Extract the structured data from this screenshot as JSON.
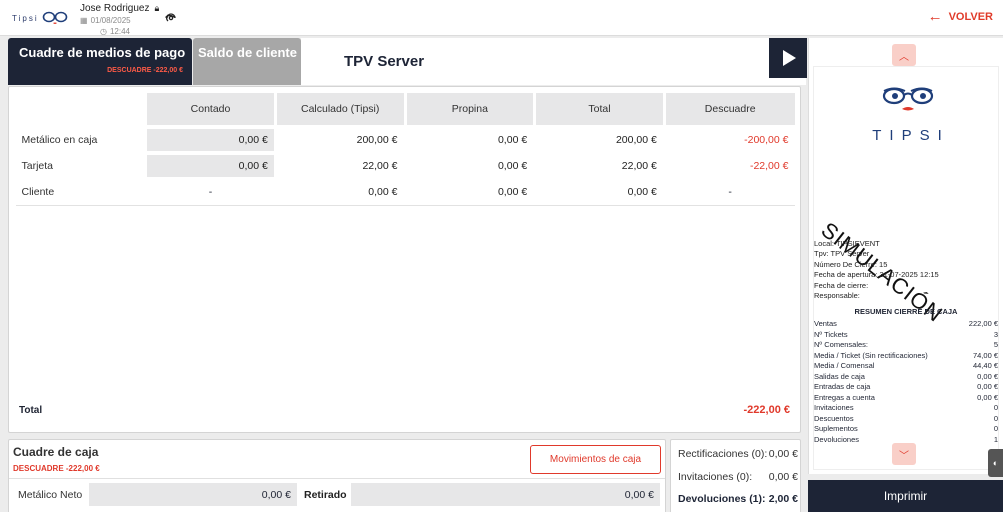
{
  "top_bar": {
    "brand": "Tipsi",
    "user_name": "Jose Rodriguez",
    "date": "01/08/2025",
    "time": "12:44",
    "back_label": "VOLVER"
  },
  "tabs": {
    "active_label": "Cuadre de medios de pago",
    "active_sub": "DESCUADRE -222,00 €",
    "inactive_label": "Saldo de cliente"
  },
  "page_title": "TPV Server",
  "table": {
    "headers": [
      "Contado",
      "Calculado (Tipsi)",
      "Propina",
      "Total",
      "Descuadre"
    ],
    "rows": [
      {
        "label": "Metálico en caja",
        "contado": "0,00 €",
        "calculado": "200,00 €",
        "propina": "0,00 €",
        "total": "200,00 €",
        "descuadre": "-200,00 €"
      },
      {
        "label": "Tarjeta",
        "contado": "0,00 €",
        "calculado": "22,00 €",
        "propina": "0,00 €",
        "total": "22,00 €",
        "descuadre": "-22,00 €"
      },
      {
        "label": "Cliente",
        "contado": "-",
        "calculado": "0,00 €",
        "propina": "0,00 €",
        "total": "0,00 €",
        "descuadre": "-"
      }
    ],
    "total_label": "Total",
    "total_value": "-222,00 €"
  },
  "cash": {
    "title": "Cuadre de caja",
    "descuadre": "DESCUADRE -222,00 €",
    "movements_button": "Movimientos de caja",
    "neto_label": "Metálico Neto",
    "neto_value": "0,00 €",
    "retirado_label": "Retirado",
    "retirado_value": "0,00 €"
  },
  "summary": {
    "rectificaciones_label": "Rectificaciones (0):",
    "rectificaciones_value": "0,00 €",
    "invitaciones_label": "Invitaciones (0):",
    "invitaciones_value": "0,00 €",
    "devoluciones_label": "Devoluciones (1):",
    "devoluciones_value": "2,00 €"
  },
  "ticket": {
    "brand": "TIPSI",
    "watermark": "SIMULACIÓN",
    "info": [
      "Local: TIPSIEVENT",
      "Tpv: TPV Server",
      "Número De Cierre: 15",
      "Fecha de apertura: 31-07-2025 12:15",
      "Fecha de cierre:",
      "Responsable:"
    ],
    "summary_title": "RESUMEN CIERRE DE CAJA",
    "summary_rows": [
      {
        "label": "Ventas",
        "value": "222,00 €"
      },
      {
        "label": "Nº Tickets",
        "value": "3"
      },
      {
        "label": "Nº Comensales:",
        "value": "5"
      },
      {
        "label": "Media / Ticket (Sin rectificaciones)",
        "value": "74,00 €"
      },
      {
        "label": "Media / Comensal",
        "value": "44,40 €"
      },
      {
        "label": "Salidas de caja",
        "value": "0,00 €"
      },
      {
        "label": "Entradas de caja",
        "value": "0,00 €"
      },
      {
        "label": "Entregas a cuenta",
        "value": "0,00 €"
      },
      {
        "label": "Invitaciones",
        "value": "0"
      },
      {
        "label": "Descuentos",
        "value": "0"
      },
      {
        "label": "Suplementos",
        "value": "0"
      },
      {
        "label": "Devoluciones",
        "value": "1"
      }
    ]
  },
  "print_button": "Imprimir",
  "colors": {
    "navy": "#1d2436",
    "accent_red": "#e0392b",
    "tab_grey": "#a7a7a7"
  },
  "icons": [
    "lock-icon",
    "calendar-icon",
    "clock-icon",
    "nfc-icon",
    "arrow-left-icon",
    "play-icon",
    "chevron-up-icon",
    "chevron-down-icon"
  ]
}
